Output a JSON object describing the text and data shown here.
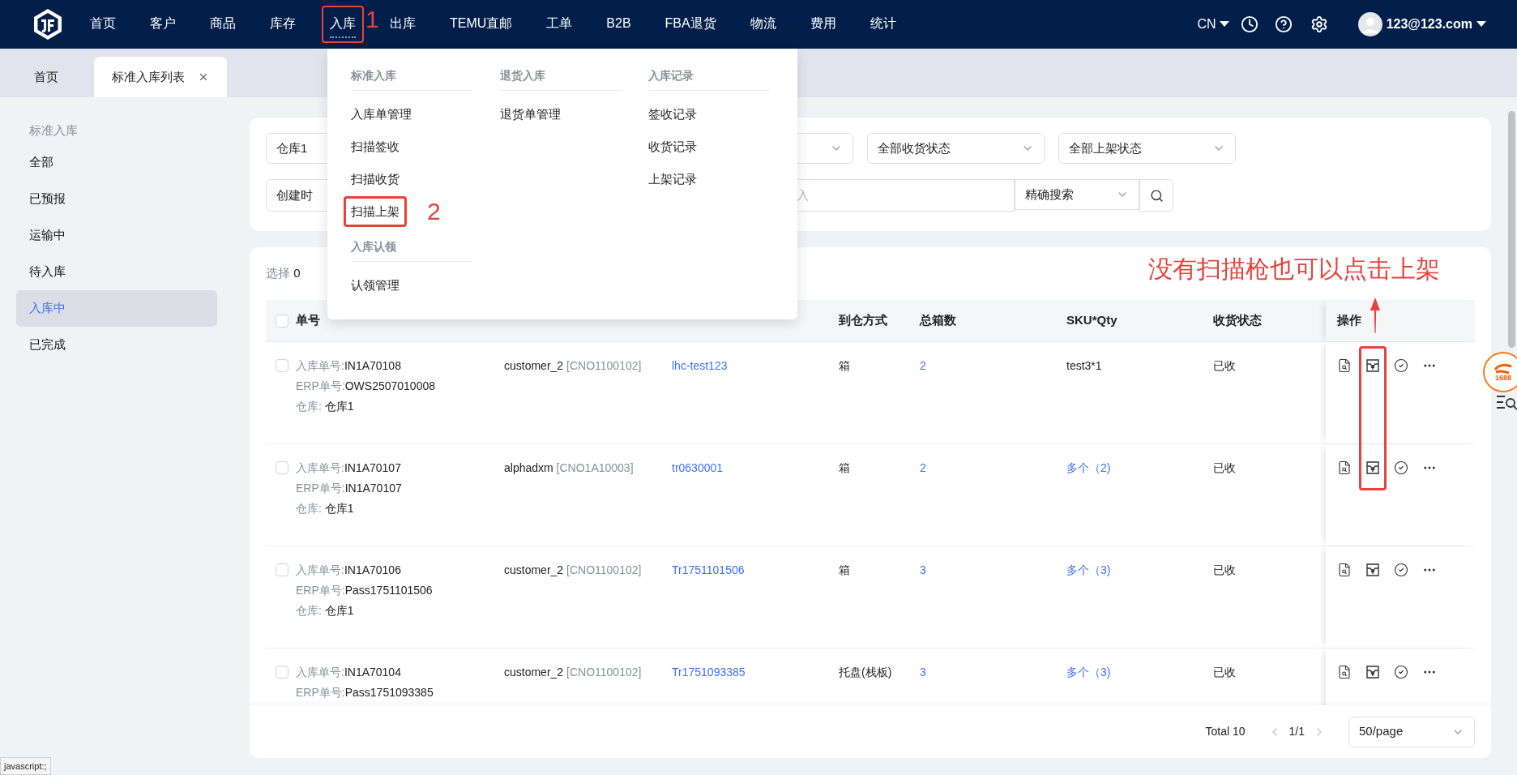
{
  "top_nav": {
    "items": [
      {
        "label": "首页",
        "selected": false,
        "annotated": false
      },
      {
        "label": "客户",
        "selected": false,
        "annotated": false
      },
      {
        "label": "商品",
        "selected": false,
        "annotated": false
      },
      {
        "label": "库存",
        "selected": false,
        "annotated": false
      },
      {
        "label": "入库",
        "selected": true,
        "annotated": true
      },
      {
        "label": "出库",
        "selected": false,
        "annotated": false
      },
      {
        "label": "TEMU直邮",
        "selected": false,
        "annotated": false
      },
      {
        "label": "工单",
        "selected": false,
        "annotated": false
      },
      {
        "label": "B2B",
        "selected": false,
        "annotated": false
      },
      {
        "label": "FBA退货",
        "selected": false,
        "annotated": false
      },
      {
        "label": "物流",
        "selected": false,
        "annotated": false
      },
      {
        "label": "费用",
        "selected": false,
        "annotated": false
      },
      {
        "label": "统计",
        "selected": false,
        "annotated": false
      }
    ],
    "language": "CN",
    "user": "123@123.com"
  },
  "tabs": [
    {
      "label": "首页",
      "selected": false,
      "closable": false
    },
    {
      "label": "标准入库列表",
      "selected": true,
      "closable": true
    }
  ],
  "sidebar": {
    "heading": "标准入库",
    "items": [
      {
        "label": "全部",
        "selected": false
      },
      {
        "label": "已预报",
        "selected": false
      },
      {
        "label": "运输中",
        "selected": false
      },
      {
        "label": "待入库",
        "selected": false
      },
      {
        "label": "入库中",
        "selected": true
      },
      {
        "label": "已完成",
        "selected": false
      }
    ]
  },
  "filters": {
    "warehouse": "仓库1",
    "receive_status": "全部收货状态",
    "shelf_status": "全部上架状态",
    "date_type": "创建时",
    "search_placeholder": "入",
    "search_mode": "精确搜索"
  },
  "toolbar": {
    "label": "选择",
    "count": "0"
  },
  "header_checked": false,
  "table": {
    "columns": {
      "order_no": "单号",
      "arrival": "到仓方式",
      "boxes": "总箱数",
      "sku": "SKU*Qty",
      "status": "收货状态",
      "actions": "操作"
    },
    "rows": [
      {
        "inbound_label": "入库单号:",
        "inbound_no": "IN1A70108",
        "erp_label": "ERP单号:",
        "erp_no": "OWS2507010008",
        "warehouse_label": "仓库:",
        "warehouse": "仓库1",
        "customer": "customer_2",
        "customer_code": "[CNO1100102]",
        "tracking": "lhc-test123",
        "arrival": "箱",
        "boxes": "2",
        "sku": "test3*1",
        "sku_link": false,
        "status": "已收",
        "upload_marked": true,
        "checked": false
      },
      {
        "inbound_label": "入库单号:",
        "inbound_no": "IN1A70107",
        "erp_label": "ERP单号:",
        "erp_no": "IN1A70107",
        "warehouse_label": "仓库:",
        "warehouse": "仓库1",
        "customer": "alphadxm",
        "customer_code": "[CNO1A10003]",
        "tracking": "tr0630001",
        "arrival": "箱",
        "boxes": "2",
        "sku": "多个（2)",
        "sku_link": true,
        "status": "已收",
        "upload_marked": true,
        "checked": false
      },
      {
        "inbound_label": "入库单号:",
        "inbound_no": "IN1A70106",
        "erp_label": "ERP单号:",
        "erp_no": "Pass1751101506",
        "warehouse_label": "仓库:",
        "warehouse": "仓库1",
        "customer": "customer_2",
        "customer_code": "[CNO1100102]",
        "tracking": "Tr1751101506",
        "arrival": "箱",
        "boxes": "3",
        "sku": "多个（3)",
        "sku_link": true,
        "status": "已收",
        "upload_marked": false,
        "checked": false
      },
      {
        "inbound_label": "入库单号:",
        "inbound_no": "IN1A70104",
        "erp_label": "ERP单号:",
        "erp_no": "Pass1751093385",
        "customer": "customer_2",
        "customer_code": "[CNO1100102]",
        "tracking": "Tr1751093385",
        "arrival": "托盘(栈板)",
        "boxes": "3",
        "sku": "多个（3)",
        "sku_link": true,
        "status": "已收",
        "upload_marked": false,
        "checked": false
      }
    ]
  },
  "pagination": {
    "total": "Total 10",
    "page": "1/1",
    "page_size": "50/page"
  },
  "menu": {
    "columns": [
      {
        "groups": [
          {
            "heading": "标准入库",
            "items": [
              {
                "label": "入库单管理",
                "annotated": false
              },
              {
                "label": "扫描签收",
                "annotated": false
              },
              {
                "label": "扫描收货",
                "annotated": false
              },
              {
                "label": "扫描上架",
                "annotated": true
              }
            ]
          },
          {
            "heading": "入库认领",
            "items": [
              {
                "label": "认领管理",
                "annotated": false
              }
            ]
          }
        ]
      },
      {
        "groups": [
          {
            "heading": "退货入库",
            "items": [
              {
                "label": "退货单管理",
                "annotated": false
              }
            ]
          }
        ]
      },
      {
        "groups": [
          {
            "heading": "入库记录",
            "items": [
              {
                "label": "签收记录",
                "annotated": false
              },
              {
                "label": "收货记录",
                "annotated": false
              },
              {
                "label": "上架记录",
                "annotated": false
              }
            ]
          }
        ]
      }
    ]
  },
  "annotations": {
    "nav_number": "1",
    "menu_number": "2",
    "note": "没有扫描枪也可以点击上架"
  },
  "widget": {
    "label": "1688"
  },
  "status_text": "javascript:;"
}
